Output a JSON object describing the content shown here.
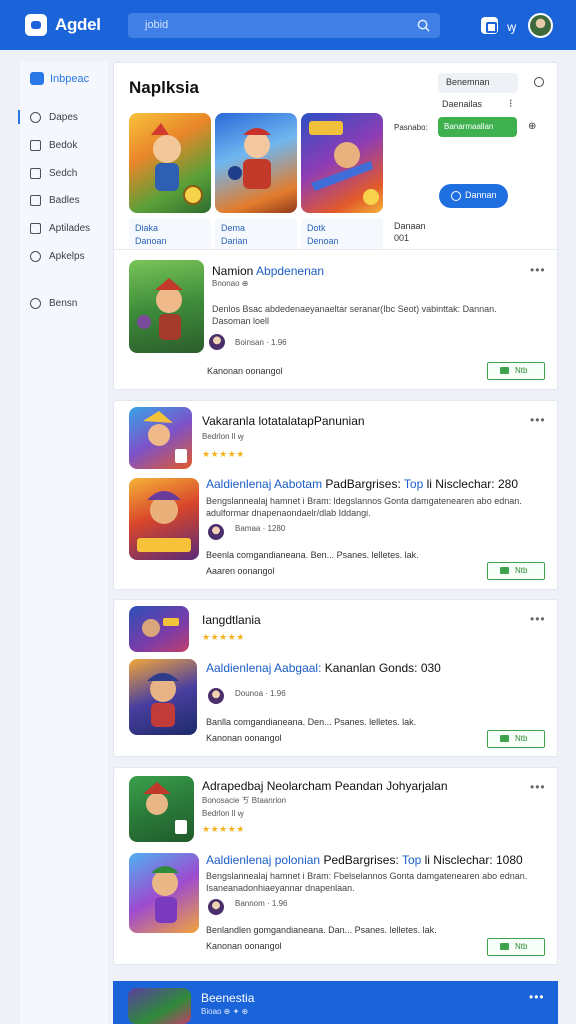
{
  "app": {
    "name": "Agdel",
    "search_placeholder": "jobid",
    "lang": "ꝡ"
  },
  "sidebar": {
    "header": "Inbpeac",
    "items": [
      {
        "label": "Dapes",
        "icon": "search-icon"
      },
      {
        "label": "Bedok",
        "icon": "book-icon"
      },
      {
        "label": "Sedch",
        "icon": "chat-icon"
      },
      {
        "label": "Badles",
        "icon": "box-icon"
      },
      {
        "label": "Aptilades",
        "icon": "library-icon"
      },
      {
        "label": "Apkelps",
        "icon": "tag-icon"
      },
      {
        "label": "Bensn",
        "icon": "search-icon"
      }
    ]
  },
  "hero": {
    "title": "Naplksia",
    "field_label": "Benemnan",
    "sort_label": "Daenailas",
    "sort_dots": "⁝",
    "filter_label": "Pasnabo:",
    "green_pill": "Banarmaallan",
    "pill_icon": "⊕",
    "blue_button": "Dannan",
    "tile_caps": [
      {
        "line1": "Diaka",
        "line2": "Danoan"
      },
      {
        "line1": "Dema",
        "line2": "Darian"
      },
      {
        "line1": "Dotk",
        "line2": "Denoan"
      }
    ],
    "plain_cap": {
      "line1": "Danaan",
      "line2": "001"
    }
  },
  "feature": {
    "title_a": "Namion ",
    "title_b": "Abpdenenan",
    "sub": "Bnonao ⊕",
    "desc1": "Denlos Bsac abdedenaeyanaeltar seranar(Ibc Seot) vabinttak: Dannan.",
    "desc2": "Dasoman loell",
    "meta": "Boinsan · 1.96",
    "footer": "Kanonan oonangol",
    "install": "Ntb"
  },
  "groups": [
    {
      "title": "Vakaranla lotatalatapPanunian",
      "sub": "Bedrlon ll ꝡ",
      "stars": "★★★★★",
      "row_title_a": "Aaldienlenaj Aabotam ",
      "row_title_b": "PadBargrises: ",
      "row_title_c": "Top",
      "row_title_d": " li Nisclechar: 280",
      "row_desc1": "Bengslannealaj hamnet i Bram: ldegslannos Gonta damgatenearen abo ednan.",
      "row_desc2": "adulformar dnapenaondaelr/dlab Iddangi.",
      "meta": "Bamaa · 1280",
      "foot1": "Beenla comgandianeana. Ben... Psanes. lelletes. lak.",
      "foot2": "Aaaren oonangol",
      "install": "Ntb"
    },
    {
      "title": "Iangdtlania",
      "sub": "",
      "stars": "★★★★★",
      "row_title_a": "Aaldienlenaj Aabgaal: ",
      "row_title_b": "Kananlan Gonds: 030",
      "meta": "Dounoa · 1.96",
      "foot1": "Banlla comgandianeana. Den... Psanes. lelletes. lak.",
      "foot2": "Kanonan oonangol",
      "install": "Ntb"
    },
    {
      "title": "Adrapedbaj Neolarcham Peandan Johyarjalan",
      "sub": "Bonosacie ㄎ Btaanrion",
      "sub2": "Bedrlon ll ꝡ",
      "stars": "★★★★★",
      "row_title_a": "Aaldienlenaj polonian ",
      "row_title_b": "PedBargrises: ",
      "row_title_c": "Top",
      "row_title_d": " li Nisclechar: 1080",
      "row_desc1": "Bengslannealaj hamnet i Bram: Fbelselannos Gonta damgatenearen abo ednan.",
      "row_desc2": "Isaneanadonhiaeyannar dnapenlaan.",
      "meta": "Bannom · 1.96",
      "foot1": "Benlandlen gomgandianeana. Dan... Psanes. lelletes. lak.",
      "foot2": "Kanonan oonangol",
      "install": "Ntb"
    }
  ],
  "bottom": {
    "title": "Beenestia",
    "sub": "Bioao ⊕ ✦ ⊕",
    "more": "•••"
  },
  "more": "•••"
}
